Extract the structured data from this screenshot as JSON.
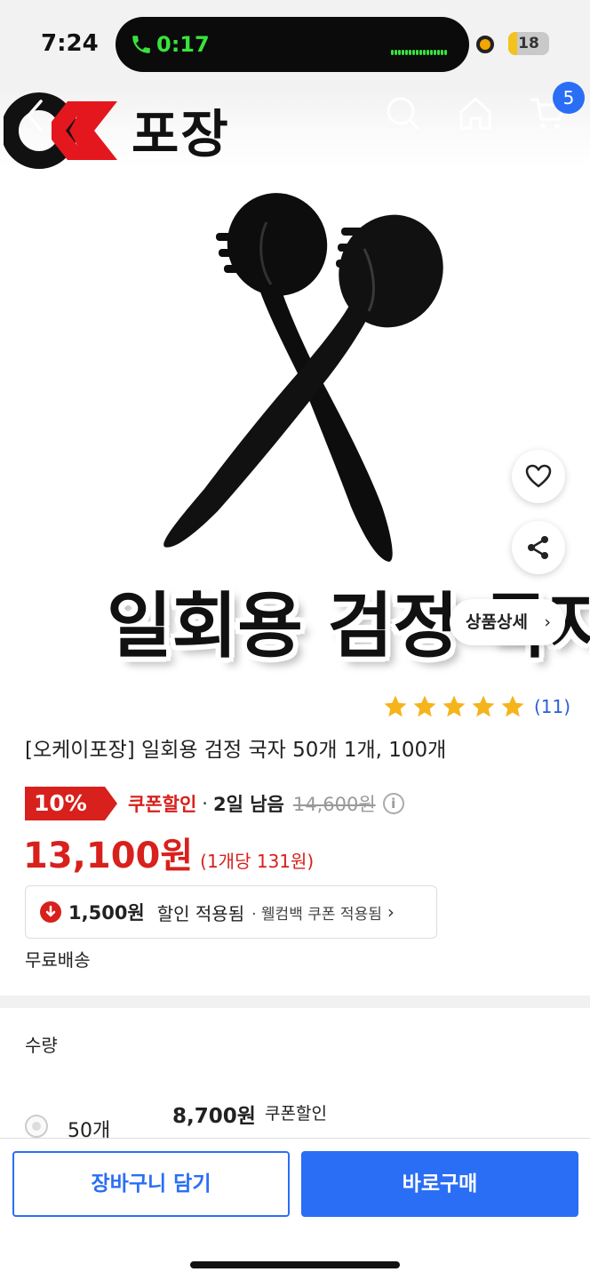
{
  "status_bar": {
    "time": "7:24",
    "call_time": "0:17",
    "battery_level": "18"
  },
  "header": {
    "brand_text": "포장",
    "cart_badge_count": "5",
    "icons": [
      "back-chevron-icon",
      "search-icon",
      "home-icon",
      "cart-icon"
    ]
  },
  "product_image": {
    "caption": "일회용 검정 국자",
    "detail_button_label": "상품상세",
    "detail_chevron": "›"
  },
  "rating": {
    "stars": 5,
    "count": "(11)"
  },
  "product": {
    "title": "[오케이포장] 일회용 검정 국자 50개 1개, 100개",
    "discount_percent": "10%",
    "coupon_label": "쿠폰할인",
    "separator": "·",
    "days_left": "2일 남음",
    "original_price": "14,600원",
    "info_icon": "i",
    "sale_price": "13,100원",
    "unit_price": "(1개당 131원)"
  },
  "coupon_box": {
    "amount": "1,500원",
    "applied_text": "할인 적용됨",
    "welcome_text": "· 웰컴백 쿠폰 적용됨",
    "chevron": "›"
  },
  "shipping": "무료배송",
  "quantity": {
    "label": "수량",
    "options": [
      {
        "name": "50개",
        "price": "8,700원",
        "coupon": "쿠폰할인"
      }
    ]
  },
  "actions": {
    "add_to_cart": "장바구니 담기",
    "buy_now": "바로구매"
  },
  "colors": {
    "accent_blue": "#2a6ef5",
    "sale_red": "#d8201c",
    "star_yellow": "#f5b41c",
    "call_green": "#38e33c"
  }
}
